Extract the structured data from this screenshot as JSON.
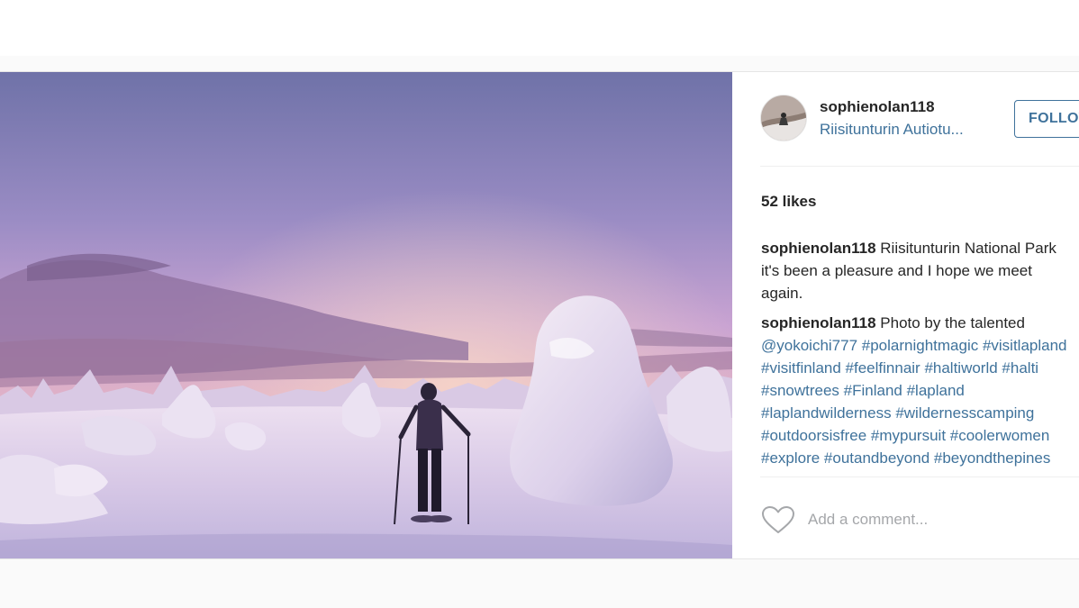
{
  "post": {
    "username": "sophienolan118",
    "location": "Riisitunturin Autiotu...",
    "follow_label": "FOLLOW",
    "likes": "52 likes",
    "comments": [
      {
        "user": "sophienolan118",
        "text": "Riisitunturin National Park it's been a pleasure and I hope we meet again."
      },
      {
        "user": "sophienolan118",
        "text": "Photo by the talented",
        "tags": "@yokoichi777 #polarnightmagic #visitlapland #visitfinland #feelfinnair #haltiworld #halti #snowtrees #Finland #lapland #laplandwilderness #wildernesscamping #outdoorsisfree #mypursuit #coolerwomen #explore #outandbeyond #beyondthepines"
      }
    ],
    "comment_placeholder": "Add a comment...",
    "icons": {
      "like": "heart-outline-icon",
      "avatar": "avatar-image"
    }
  },
  "colors": {
    "link_blue": "#3f729b",
    "text_dark": "#262626",
    "placeholder_gray": "#a5a7aa"
  }
}
